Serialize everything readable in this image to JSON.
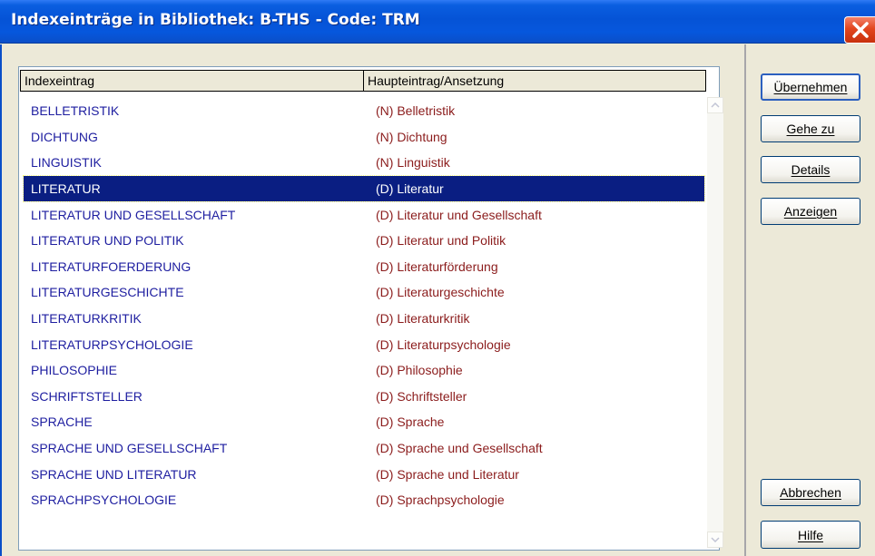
{
  "window": {
    "title": "Indexeinträge in Bibliothek: B-THS - Code: TRM"
  },
  "table": {
    "columns": [
      "Indexeintrag",
      "Haupteintrag/Ansetzung"
    ],
    "rows": [
      [
        "BELLETRISTIK",
        "(N) Belletristik"
      ],
      [
        "DICHTUNG",
        "(N) Dichtung"
      ],
      [
        "LINGUISTIK",
        "(N) Linguistik"
      ],
      [
        "LITERATUR",
        "(D) Literatur"
      ],
      [
        "LITERATUR UND GESELLSCHAFT",
        "(D) Literatur und Gesellschaft"
      ],
      [
        "LITERATUR UND POLITIK",
        "(D) Literatur und Politik"
      ],
      [
        "LITERATURFOERDERUNG",
        "(D) Literaturförderung"
      ],
      [
        "LITERATURGESCHICHTE",
        "(D) Literaturgeschichte"
      ],
      [
        "LITERATURKRITIK",
        "(D) Literaturkritik"
      ],
      [
        "LITERATURPSYCHOLOGIE",
        "(D) Literaturpsychologie"
      ],
      [
        "PHILOSOPHIE",
        "(D) Philosophie"
      ],
      [
        "SCHRIFTSTELLER",
        "(D) Schriftsteller"
      ],
      [
        "SPRACHE",
        "(D) Sprache"
      ],
      [
        "SPRACHE UND GESELLSCHAFT",
        "(D) Sprache und Gesellschaft"
      ],
      [
        "SPRACHE UND LITERATUR",
        "(D) Sprache und Literatur"
      ],
      [
        "SPRACHPSYCHOLOGIE",
        "(D) Sprachpsychologie"
      ]
    ],
    "selected_index": 3
  },
  "buttons": {
    "uebernehmen": "Übernehmen",
    "gehe_zu": "Gehe zu",
    "details": "Details",
    "anzeigen": "Anzeigen",
    "abbrechen": "Abbrechen",
    "hilfe": "Hilfe"
  },
  "icons": {
    "close": "close-icon",
    "scroll_up": "chevron-up-icon",
    "scroll_down": "chevron-down-icon"
  },
  "colors": {
    "titlebar": "#0553d6",
    "selection": "#0a1e82",
    "entry_text": "#1e1ea0",
    "main_entry_text": "#8b1c1c",
    "close_button": "#e2461e"
  }
}
